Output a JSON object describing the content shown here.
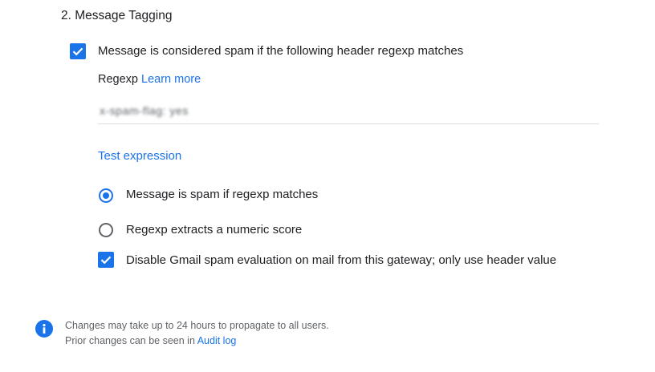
{
  "section": {
    "title": "2. Message Tagging"
  },
  "spam_header_checkbox": {
    "checked": true,
    "label": "Message is considered spam if the following header regexp matches"
  },
  "regexp": {
    "label": "Regexp",
    "learn_more": "Learn more",
    "value": "x-spam-flag: yes"
  },
  "test_expression": "Test expression",
  "mode": {
    "options": [
      {
        "label": "Message is spam if regexp matches",
        "selected": true
      },
      {
        "label": "Regexp extracts a numeric score",
        "selected": false
      }
    ]
  },
  "disable_gmail_checkbox": {
    "checked": true,
    "label": "Disable Gmail spam evaluation on mail from this gateway; only use header value"
  },
  "footer": {
    "line1": "Changes may take up to 24 hours to propagate to all users.",
    "line2_prefix": "Prior changes can be seen in",
    "audit_log": "Audit log"
  },
  "colors": {
    "accent": "#1a73e8",
    "text": "#202124",
    "secondary_text": "#5f6368",
    "divider": "#dadce0"
  },
  "icons": [
    "checkmark-icon",
    "radio-selected-icon",
    "radio-unselected-icon",
    "info-icon"
  ]
}
